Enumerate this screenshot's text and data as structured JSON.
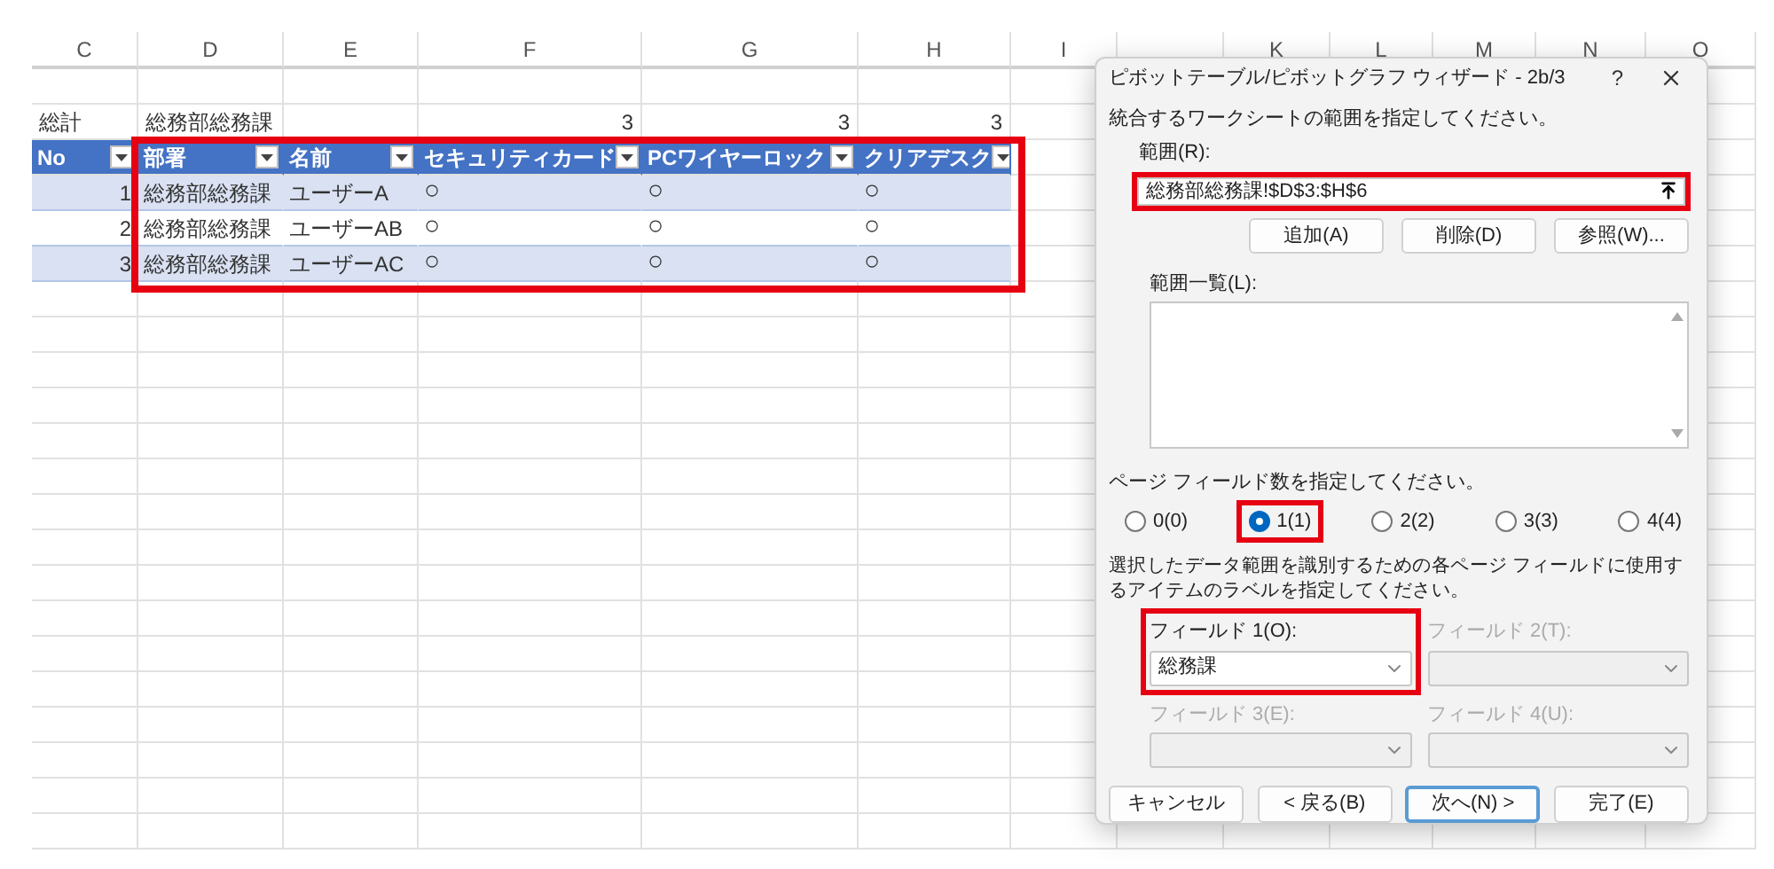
{
  "sheet": {
    "column_headers": [
      "C",
      "D",
      "E",
      "F",
      "G",
      "H",
      "I",
      "K",
      "L",
      "M",
      "N",
      "O"
    ],
    "summary": {
      "label": "総計",
      "group": "総務部総務課",
      "values": [
        "3",
        "3",
        "3"
      ]
    },
    "table": {
      "highlighted": true,
      "columns": [
        "No",
        "部署",
        "名前",
        "セキュリティカード",
        "PCワイヤーロック",
        "クリアデスク"
      ],
      "rows": [
        [
          "1",
          "総務部総務課",
          "ユーザーA",
          "○",
          "○",
          "○"
        ],
        [
          "2",
          "総務部総務課",
          "ユーザーAB",
          "○",
          "○",
          "○"
        ],
        [
          "3",
          "総務部総務課",
          "ユーザーAC",
          "○",
          "○",
          "○"
        ]
      ]
    }
  },
  "dialog": {
    "title": "ピボットテーブル/ピボットグラフ ウィザード - 2b/3",
    "help": "?",
    "instruction": "統合するワークシートの範囲を指定してください。",
    "range": {
      "label": "範囲(R):",
      "value": "総務部総務課!$D$3:$H$6",
      "highlighted": true
    },
    "range_buttons": [
      "追加(A)",
      "削除(D)",
      "参照(W)..."
    ],
    "list": {
      "label": "範囲一覧(L):"
    },
    "page_fields_prompt": "ページ フィールド数を指定してください。",
    "page_field_options": [
      {
        "label": "0(0)",
        "selected": false,
        "highlighted": false
      },
      {
        "label": "1(1)",
        "selected": true,
        "highlighted": true
      },
      {
        "label": "2(2)",
        "selected": false,
        "highlighted": false
      },
      {
        "label": "3(3)",
        "selected": false,
        "highlighted": false
      },
      {
        "label": "4(4)",
        "selected": false,
        "highlighted": false
      }
    ],
    "label_prompt": "選択したデータ範囲を識別するための各ページ フィールドに使用するアイテムのラベルを指定してください。",
    "fields": [
      {
        "label": "フィールド 1(O):",
        "value": "総務課",
        "disabled": false,
        "highlighted": true
      },
      {
        "label": "フィールド 2(T):",
        "disabled": true,
        "highlighted": false
      },
      {
        "label": "フィールド 3(E):",
        "disabled": true,
        "highlighted": false
      },
      {
        "label": "フィールド 4(U):",
        "disabled": true,
        "highlighted": false
      }
    ],
    "buttons": [
      {
        "label": "キャンセル",
        "default": false
      },
      {
        "label": "< 戻る(B)",
        "default": false
      },
      {
        "label": "次へ(N) >",
        "default": true
      },
      {
        "label": "完了(E)",
        "default": false
      }
    ]
  }
}
